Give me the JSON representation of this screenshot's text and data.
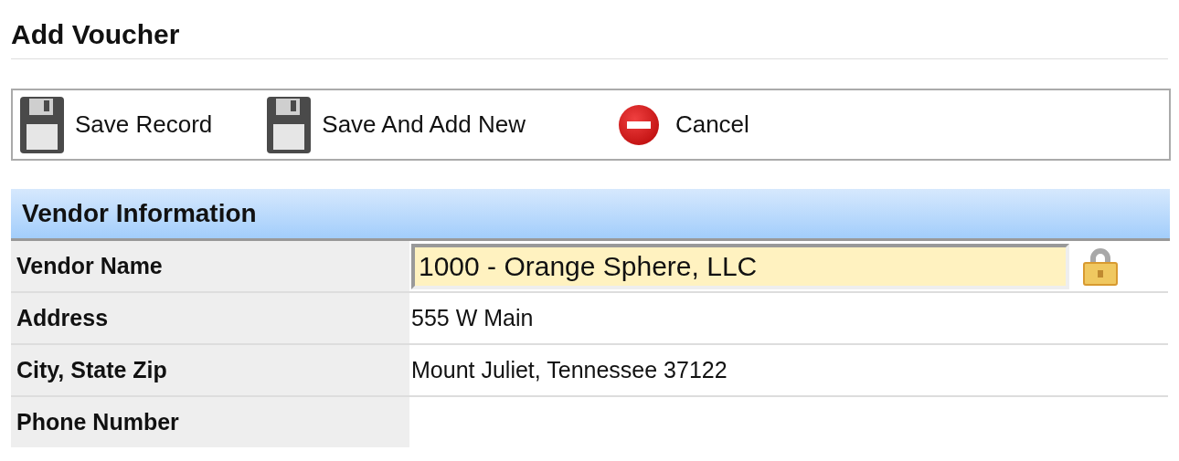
{
  "title": "Add Voucher",
  "toolbar": [
    {
      "label": "Save Record",
      "kind": "save"
    },
    {
      "label": "Save And Add New",
      "kind": "save"
    },
    {
      "label": "Cancel",
      "kind": "cancel"
    }
  ],
  "section": {
    "title": "Vendor Information",
    "rows": [
      {
        "label": "Vendor Name",
        "kind": "input",
        "value": "1000 - Orange Sphere, LLC",
        "locked": true
      },
      {
        "label": "Address",
        "kind": "text",
        "value": "555 W Main"
      },
      {
        "label": "City, State Zip",
        "kind": "text",
        "value": "Mount Juliet, Tennessee 37122"
      },
      {
        "label": "Phone Number",
        "kind": "text"
      }
    ]
  }
}
